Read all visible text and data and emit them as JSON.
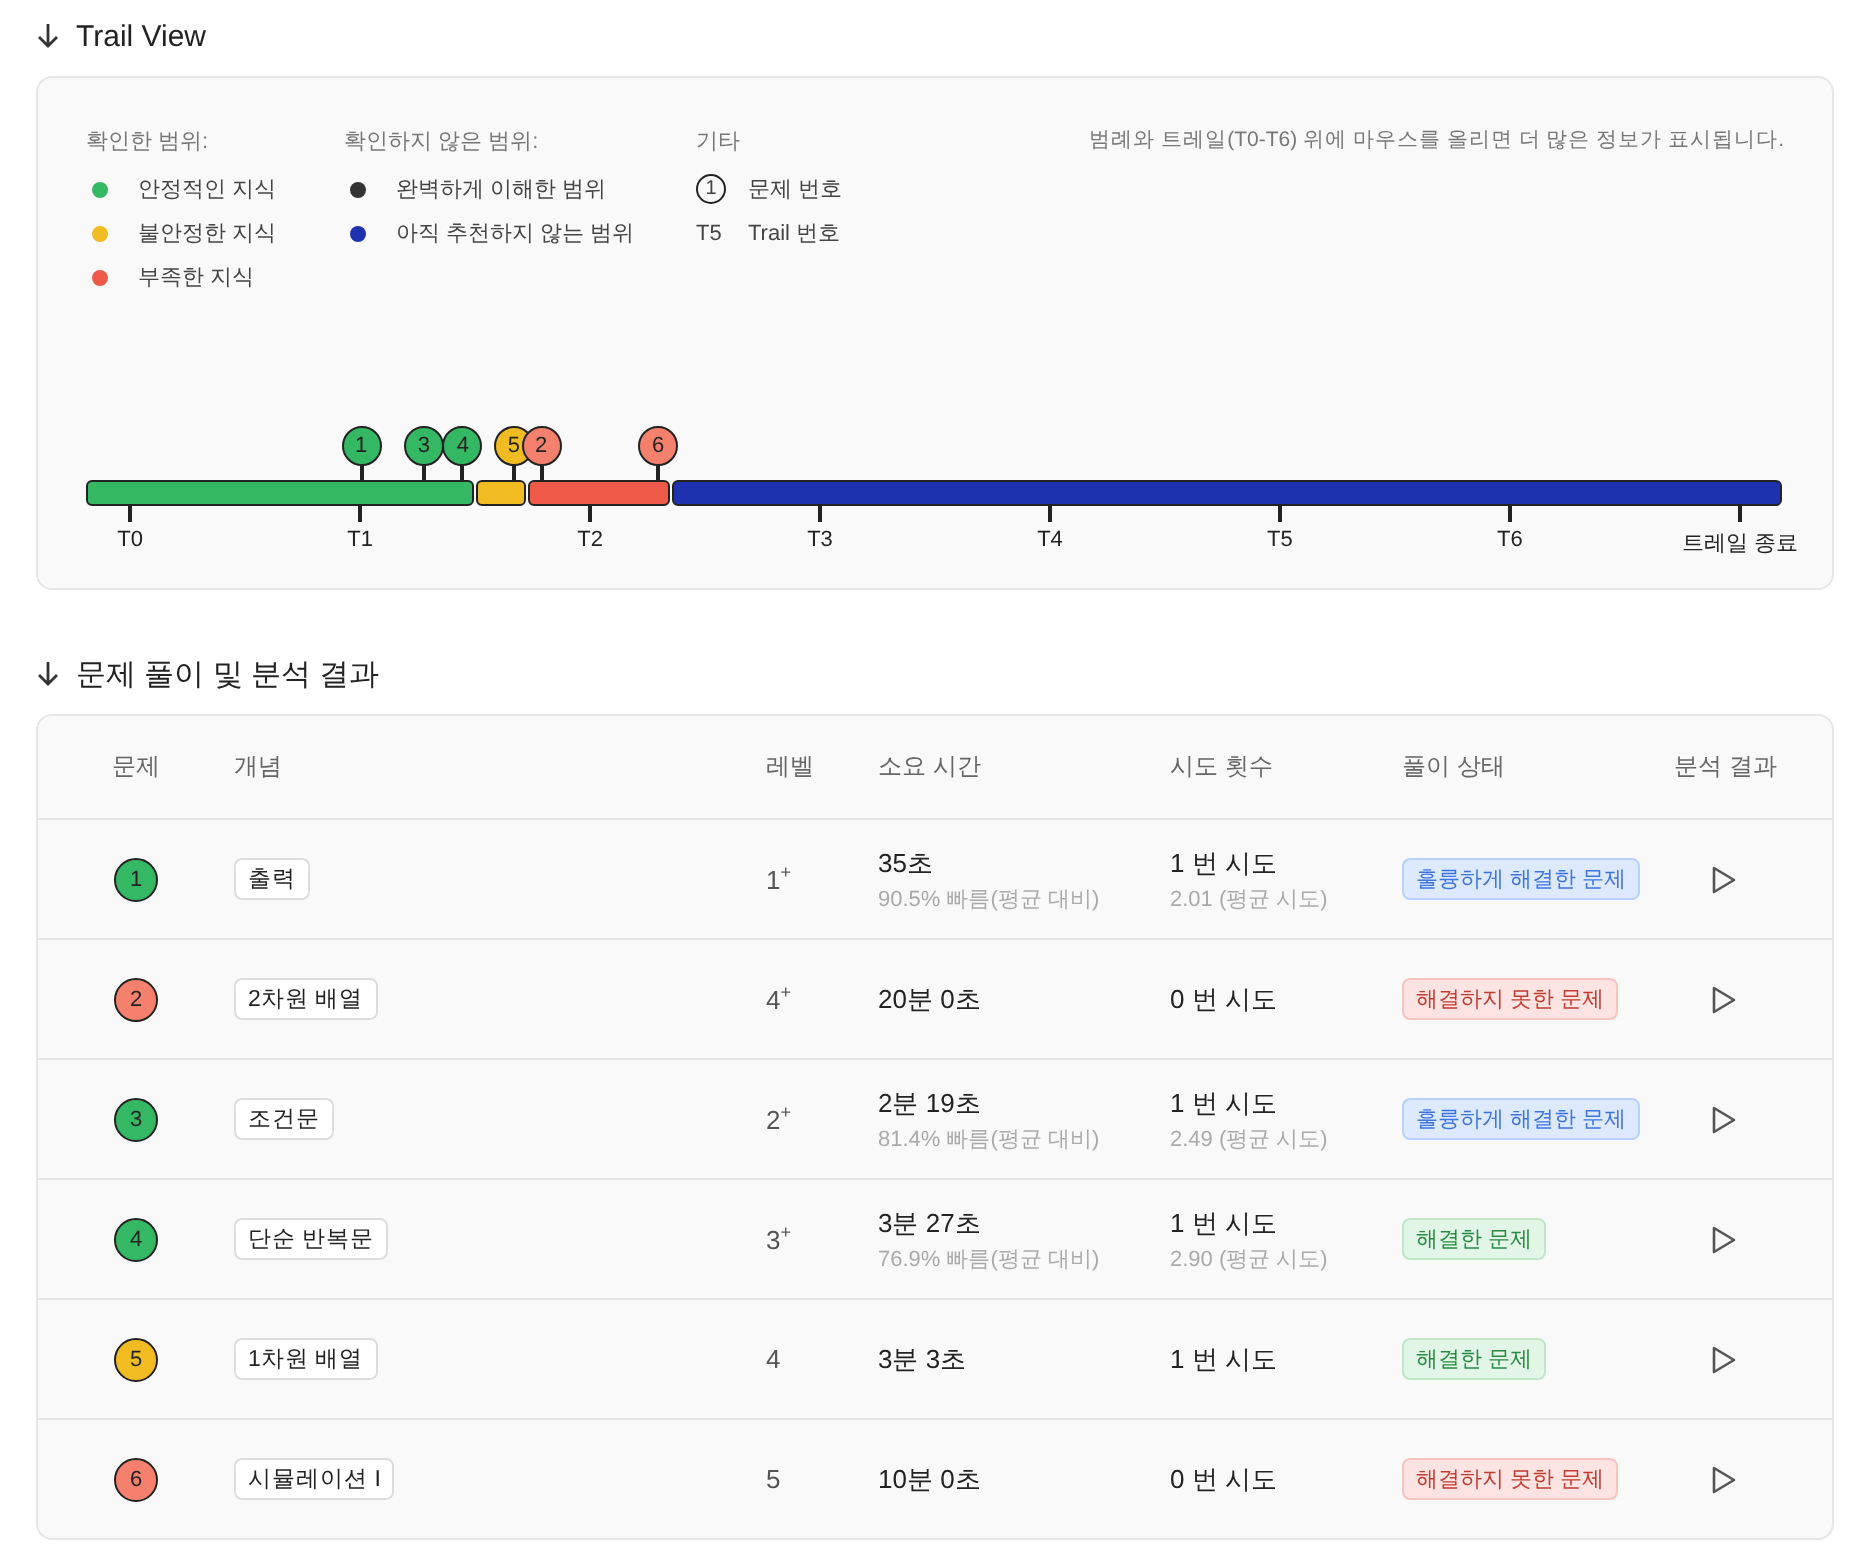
{
  "trail_view": {
    "title": "Trail View",
    "legend": [
      {
        "title": "확인한 범위:",
        "items": [
          {
            "kind": "dot",
            "label": "안정적인 지식",
            "color": "#34b864"
          },
          {
            "kind": "dot",
            "label": "불안정한 지식",
            "color": "#f0bc22"
          },
          {
            "kind": "dot",
            "label": "부족한 지식",
            "color": "#ef5a48"
          }
        ]
      },
      {
        "title": "확인하지 않은 범위:",
        "items": [
          {
            "kind": "dot",
            "label": "완벽하게 이해한 범위",
            "color": "#333333"
          },
          {
            "kind": "dot",
            "label": "아직 추천하지 않는 범위",
            "color": "#1e32b0"
          }
        ]
      },
      {
        "title": "기타",
        "items": [
          {
            "kind": "problem",
            "symbol": "1",
            "label": "문제 번호"
          },
          {
            "kind": "trail",
            "symbol": "T5",
            "label": "Trail 번호"
          }
        ]
      }
    ],
    "hint": "범례와 트레일(T0-T6) 위에 마우스를 올리면 더 많은 정보가 표시됩니다.",
    "segments": [
      {
        "color": "#34b864",
        "markers": [
          {
            "label": "1",
            "level": 0.162,
            "color": "#34b864"
          },
          {
            "label": "3",
            "level": 0.199,
            "color": "#34b864"
          },
          {
            "label": "4",
            "level": 0.222,
            "color": "#34b864"
          }
        ]
      },
      {
        "color": "#f0bc22",
        "markers": [
          {
            "label": "5",
            "level": 0.252,
            "color": "#f0bc22"
          }
        ]
      },
      {
        "color": "#ef5a48",
        "markers": [
          {
            "label": "2",
            "level": 0.268,
            "color": "#f5806e"
          },
          {
            "label": "6",
            "level": 0.337,
            "color": "#f5806e"
          }
        ]
      },
      {
        "color": "#1e32b0"
      }
    ],
    "ticks": [
      "T0",
      "T1",
      "T2",
      "T3",
      "T4",
      "T5",
      "T6",
      "트레일 종료"
    ]
  },
  "results": {
    "title": "문제 풀이 및 분석 결과",
    "columns": [
      "문제",
      "개념",
      "레벨",
      "소요 시간",
      "시도 횟수",
      "풀이 상태",
      "분석 결과"
    ],
    "rows": [
      {
        "number": "1",
        "color": "#34b864",
        "concept": "출력",
        "level_text": "1$^{+}$",
        "time": "35초",
        "time_note": "90.5% 빠름(평균 대비)",
        "attempts": "1 번 시도",
        "attempts_note": "2.01 (평균 시도)",
        "status": "훌륭하게 해결한 문제",
        "kind": "excellent"
      },
      {
        "number": "2",
        "color": "#f5806e",
        "concept": "2차원 배열",
        "level_text": "4$^{+}$",
        "time": "20분 0초",
        "attempts": "0 번 시도",
        "status": "해결하지 못한 문제",
        "kind": "failed"
      },
      {
        "number": "3",
        "color": "#34b864",
        "concept": "조건문",
        "level_text": "2$^{+}$",
        "time": "2분 19초",
        "time_note": "81.4% 빠름(평균 대비)",
        "attempts": "1 번 시도",
        "attempts_note": "2.49 (평균 시도)",
        "status": "훌륭하게 해결한 문제",
        "kind": "excellent"
      },
      {
        "number": "4",
        "color": "#34b864",
        "concept": "단순 반복문",
        "level_text": "3$^{+}$",
        "time": "3분 27초",
        "time_note": "76.9% 빠름(평균 대비)",
        "attempts": "1 번 시도",
        "attempts_note": "2.90 (평균 시도)",
        "status": "해결한 문제",
        "kind": "solved"
      },
      {
        "number": "5",
        "color": "#f0bc22",
        "concept": "1차원 배열",
        "level_text": "4",
        "time": "3분 3초",
        "attempts": "1 번 시도",
        "status": "해결한 문제",
        "kind": "solved"
      },
      {
        "number": "6",
        "color": "#f5806e",
        "concept": "시뮬레이션 I",
        "level_text": "5",
        "time": "10분 0초",
        "attempts": "0 번 시도",
        "status": "해결하지 못한 문제",
        "kind": "failed"
      }
    ]
  }
}
